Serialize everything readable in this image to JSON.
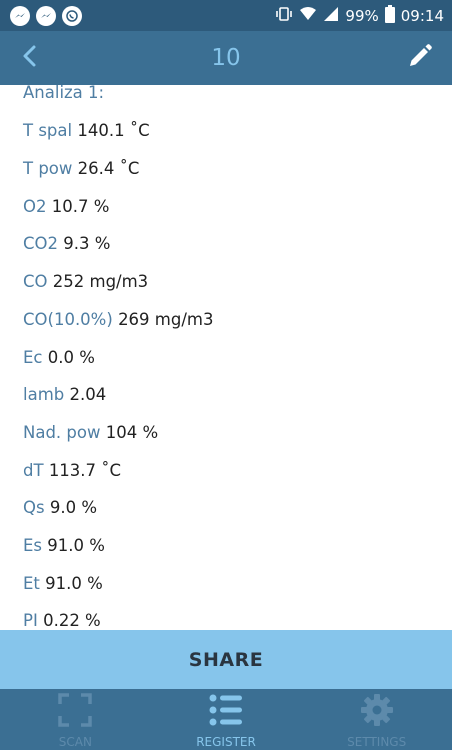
{
  "status_bar": {
    "battery": "99%",
    "time": "09:14"
  },
  "app_bar": {
    "title": "10"
  },
  "content": {
    "heading": "Analiza 1:",
    "rows": [
      {
        "label": "T spal",
        "value": "140.1 ˚C"
      },
      {
        "label": "T pow",
        "value": "26.4 ˚C"
      },
      {
        "label": "O2",
        "value": "10.7 %"
      },
      {
        "label": "CO2",
        "value": "9.3 %"
      },
      {
        "label": "CO",
        "value": "252 mg/m3"
      },
      {
        "label": "CO(10.0%)",
        "value": "269 mg/m3"
      },
      {
        "label": "Ec",
        "value": "0.0 %"
      },
      {
        "label": "lamb",
        "value": "2.04"
      },
      {
        "label": "Nad. pow",
        "value": "104 %"
      },
      {
        "label": "dT",
        "value": "113.7 ˚C"
      },
      {
        "label": "Qs",
        "value": "9.0 %"
      },
      {
        "label": "Es",
        "value": "91.0 %"
      },
      {
        "label": "Et",
        "value": "91.0 %"
      },
      {
        "label": "PI",
        "value": "0.22 %"
      }
    ]
  },
  "share": {
    "label": "SHARE"
  },
  "bottom_nav": {
    "items": [
      {
        "label": "SCAN",
        "icon": "scan-icon",
        "active": false
      },
      {
        "label": "REGISTER",
        "icon": "list-icon",
        "active": true
      },
      {
        "label": "SETTINGS",
        "icon": "gear-icon",
        "active": false
      }
    ]
  },
  "colors": {
    "status_bar": "#2d5a7b",
    "app_bar": "#3b6f93",
    "accent": "#86c5eb",
    "label": "#4f7ea3",
    "value": "#222222"
  }
}
